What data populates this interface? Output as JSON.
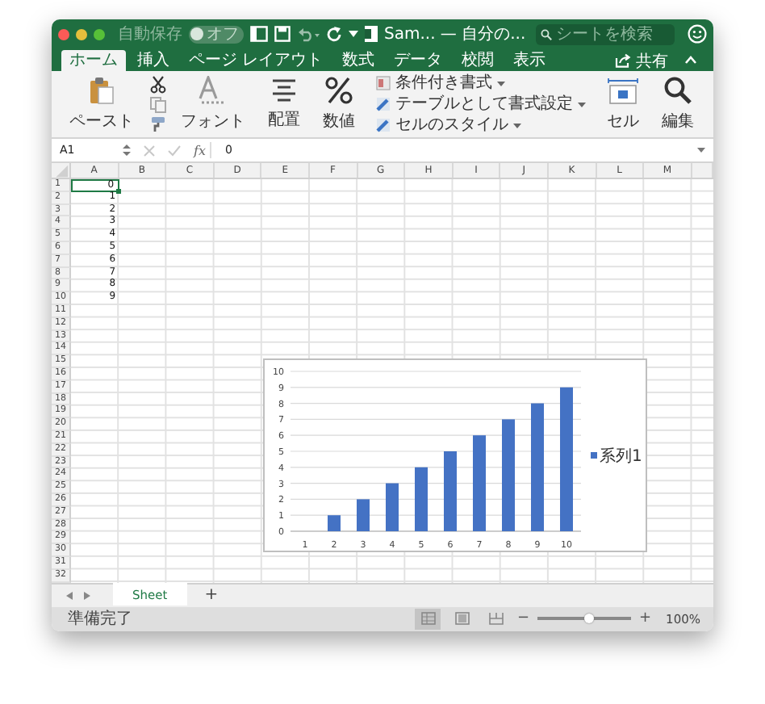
{
  "window": {
    "title": "Sam... — 自分の...",
    "autosave_label": "自動保存",
    "autosave_state": "オフ",
    "search_placeholder": "シートを検索"
  },
  "tabs": [
    {
      "label": "ホーム",
      "selected": true
    },
    {
      "label": "挿入",
      "selected": false
    },
    {
      "label": "ページ レイアウト",
      "selected": false
    },
    {
      "label": "数式",
      "selected": false
    },
    {
      "label": "データ",
      "selected": false
    },
    {
      "label": "校閲",
      "selected": false
    },
    {
      "label": "表示",
      "selected": false
    }
  ],
  "share_label": "共有",
  "ribbon": {
    "paste": "ペースト",
    "font": "フォント",
    "alignment": "配置",
    "number": "数値",
    "styles": [
      "条件付き書式",
      "テーブルとして書式設定",
      "セルのスタイル"
    ],
    "cells": "セル",
    "editing": "編集"
  },
  "formula_bar": {
    "name_box": "A1",
    "fx": "fx",
    "value": "0"
  },
  "columns": [
    "A",
    "B",
    "C",
    "D",
    "E",
    "F",
    "G",
    "H",
    "I",
    "J",
    "K",
    "L",
    "M"
  ],
  "rows": [
    {
      "label": "1",
      "value": "0",
      "selected": true
    },
    {
      "label": "2",
      "value": "1",
      "selected": false
    },
    {
      "label": "3",
      "value": "2",
      "selected": false
    },
    {
      "label": "4",
      "value": "3",
      "selected": false
    },
    {
      "label": "5",
      "value": "4",
      "selected": false
    },
    {
      "label": "6",
      "value": "5",
      "selected": false
    },
    {
      "label": "7",
      "value": "6",
      "selected": false
    },
    {
      "label": "8",
      "value": "7",
      "selected": false
    },
    {
      "label": "9",
      "value": "8",
      "selected": false
    },
    {
      "label": "10",
      "value": "9",
      "selected": false
    },
    {
      "label": "11",
      "selected": false
    },
    {
      "label": "12",
      "selected": false
    },
    {
      "label": "13",
      "selected": false
    },
    {
      "label": "14",
      "selected": false
    },
    {
      "label": "15",
      "selected": false
    },
    {
      "label": "16",
      "selected": false
    },
    {
      "label": "17",
      "selected": false
    },
    {
      "label": "18",
      "selected": false
    },
    {
      "label": "19",
      "selected": false
    },
    {
      "label": "20",
      "selected": false
    },
    {
      "label": "21",
      "selected": false
    },
    {
      "label": "22",
      "selected": false
    },
    {
      "label": "23",
      "selected": false
    },
    {
      "label": "24",
      "selected": false
    },
    {
      "label": "25",
      "selected": false
    },
    {
      "label": "26",
      "selected": false
    },
    {
      "label": "27",
      "selected": false
    },
    {
      "label": "28",
      "selected": false
    },
    {
      "label": "29",
      "selected": false
    },
    {
      "label": "30",
      "selected": false
    },
    {
      "label": "31",
      "selected": false
    },
    {
      "label": "32",
      "selected": false
    }
  ],
  "chart": {
    "chart_data": {
      "type": "bar",
      "categories": [
        "1",
        "2",
        "3",
        "4",
        "5",
        "6",
        "7",
        "8",
        "9",
        "10"
      ],
      "series": [
        {
          "name": "系列1",
          "color": "#4472c4",
          "values": [
            0,
            1,
            2,
            3,
            4,
            5,
            6,
            7,
            8,
            9
          ]
        }
      ],
      "ylim": [
        0,
        10
      ],
      "grid": true,
      "yticks": [
        0,
        1,
        2,
        3,
        4,
        5,
        6,
        7,
        8,
        9,
        10
      ]
    }
  },
  "sheet_tabs": [
    {
      "label": "Sheet",
      "selected": true
    }
  ],
  "add_sheet": "+",
  "status_bar": {
    "status": "準備完了",
    "views": [
      {
        "kind": "normal",
        "selected": true
      },
      {
        "kind": "page_layout",
        "selected": false
      },
      {
        "kind": "page_break",
        "selected": false
      }
    ],
    "zoom_out": "−",
    "zoom_in": "+",
    "zoom": {
      "level": 0.55
    },
    "zoom_reading": "100%"
  }
}
